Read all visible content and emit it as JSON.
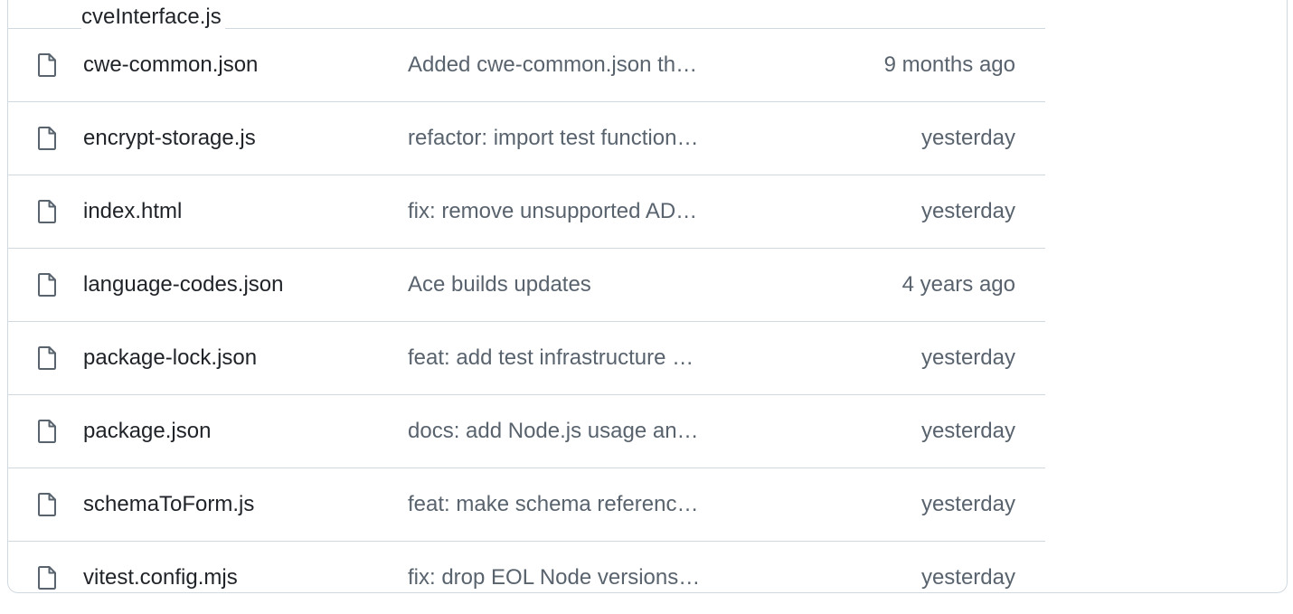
{
  "partial_file": {
    "name": "cveInterface.js"
  },
  "files": [
    {
      "name": "cwe-common.json",
      "commit": "Added cwe-common.json th…",
      "date": "9 months ago",
      "icon": "file-icon"
    },
    {
      "name": "encrypt-storage.js",
      "commit": "refactor: import test function…",
      "date": "yesterday",
      "icon": "file-icon"
    },
    {
      "name": "index.html",
      "commit": "fix: remove unsupported AD…",
      "date": "yesterday",
      "icon": "file-icon"
    },
    {
      "name": "language-codes.json",
      "commit": "Ace builds updates",
      "date": "4 years ago",
      "icon": "file-icon"
    },
    {
      "name": "package-lock.json",
      "commit": "feat: add test infrastructure …",
      "date": "yesterday",
      "icon": "file-icon"
    },
    {
      "name": "package.json",
      "commit": "docs: add Node.js usage an…",
      "date": "yesterday",
      "icon": "file-icon"
    },
    {
      "name": "schemaToForm.js",
      "commit": "feat: make schema referenc…",
      "date": "yesterday",
      "icon": "file-icon"
    },
    {
      "name": "vitest.config.mjs",
      "commit": "fix: drop EOL Node versions…",
      "date": "yesterday",
      "icon": "file-icon"
    }
  ],
  "colors": {
    "text_primary": "#1f2328",
    "text_muted": "#59636e",
    "border": "#d1d9e0"
  }
}
